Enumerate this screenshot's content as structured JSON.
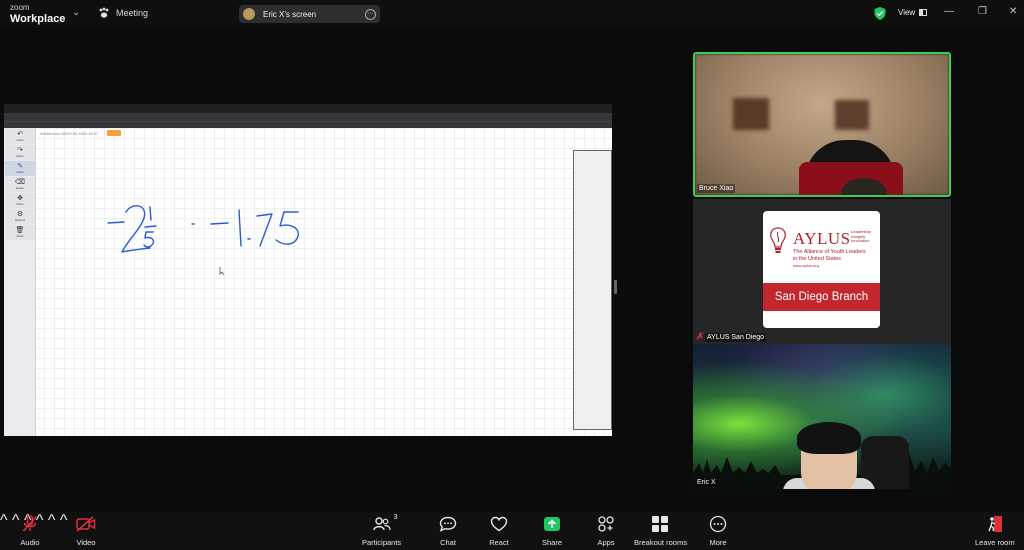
{
  "titlebar": {
    "brand_small": "zoom",
    "brand_large": "Workplace",
    "meeting_label": "Meeting",
    "share_label": "Eric X's screen",
    "view_label": "View"
  },
  "whiteboard": {
    "title": "Whiteboard 8525793-4820-0030",
    "tools": [
      {
        "label": "Undo",
        "glyph": "↶"
      },
      {
        "label": "Redo",
        "glyph": "↷"
      },
      {
        "label": "Draw",
        "glyph": "✎"
      },
      {
        "label": "Erase",
        "glyph": "⌫"
      },
      {
        "label": "Move",
        "glyph": "✥"
      },
      {
        "label": "Options",
        "glyph": "⚙"
      },
      {
        "label": "Clear",
        "glyph": "🗑"
      }
    ],
    "ink_color": "#2a5bd0"
  },
  "participants": [
    {
      "name": "Bruce Xiao"
    },
    {
      "name": "AYLUS San Diego"
    },
    {
      "name": "Eric X"
    }
  ],
  "logo": {
    "title": "AYLUS",
    "side": [
      "Leadership",
      "Integrity",
      "Innovation"
    ],
    "subtitle_1": "The Alliance of Youth Leaders",
    "subtitle_2": "in the United States",
    "url": "www.aylus.org",
    "band": "San Diego Branch"
  },
  "toolbar": {
    "audio": "Audio",
    "video": "Video",
    "participants": "Participants",
    "participants_count": "3",
    "chat": "Chat",
    "react": "React",
    "share": "Share",
    "apps": "Apps",
    "breakout": "Breakout rooms",
    "more": "More",
    "leave": "Leave room"
  },
  "colors": {
    "active_speaker": "#3ccc5a",
    "muted_red": "#e0313b",
    "share_green": "#22c55e",
    "aylus_red": "#c1272d"
  }
}
